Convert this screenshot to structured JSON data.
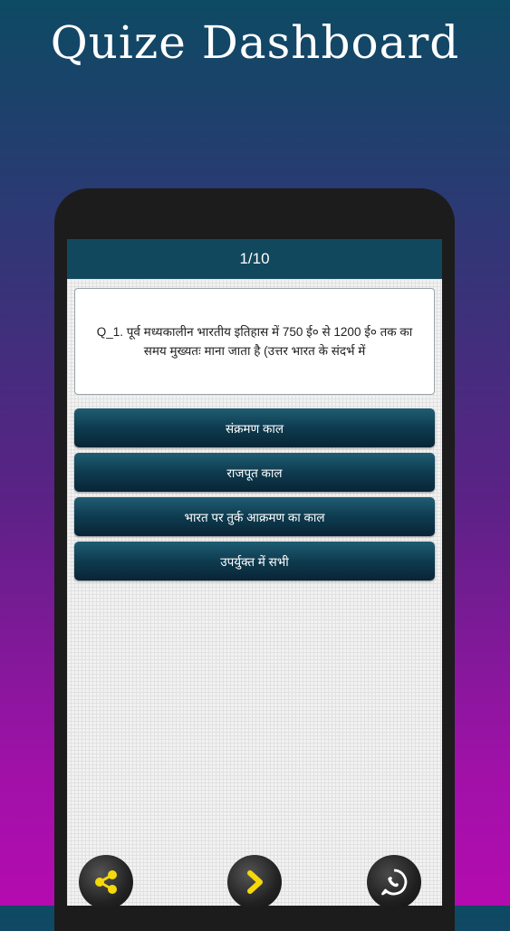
{
  "page": {
    "title": "Quize Dashboard"
  },
  "quiz": {
    "progress": "1/10",
    "question": "Q_1. पूर्व मध्यकालीन भारतीय इतिहास में 750 ई० से 1200 ई० तक का समय मुख्यतः माना जाता है (उत्तर भारत के संदर्भ में",
    "options": [
      "संक्रमण काल",
      "राजपूत काल",
      "भारत पर तुर्क आक्रमण का काल",
      "उपर्युक्त में सभी"
    ]
  },
  "bottom_bar": {
    "share_icon": "share-icon",
    "next_icon": "chevron-right-icon",
    "whatsapp_icon": "whatsapp-icon"
  },
  "colors": {
    "header": "#12485d",
    "option_button": "#0e3b4f",
    "icon_yellow": "#f5d90a"
  }
}
